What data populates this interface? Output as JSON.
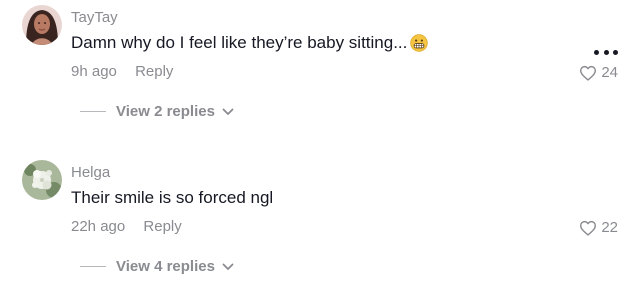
{
  "comments": [
    {
      "username": "TayTay",
      "text": "Damn why do I feel like they’re baby sitting...",
      "emoji": "grimacing-face-emoji",
      "time": "9h ago",
      "reply_label": "Reply",
      "likes": "24",
      "view_replies": "View 2 replies",
      "avatar": "woman-portrait-avatar"
    },
    {
      "username": "Helga",
      "text": "Their smile is so forced ngl",
      "time": "22h ago",
      "reply_label": "Reply",
      "likes": "22",
      "view_replies": "View 4 replies",
      "avatar": "flowers-avatar"
    }
  ],
  "icons": {
    "like": "heart-outline-icon",
    "more": "more-dots-icon",
    "expand": "chevron-down-icon"
  },
  "colors": {
    "text": "#161823",
    "secondary": "#8a8b91",
    "emoji": "#f5c542"
  }
}
